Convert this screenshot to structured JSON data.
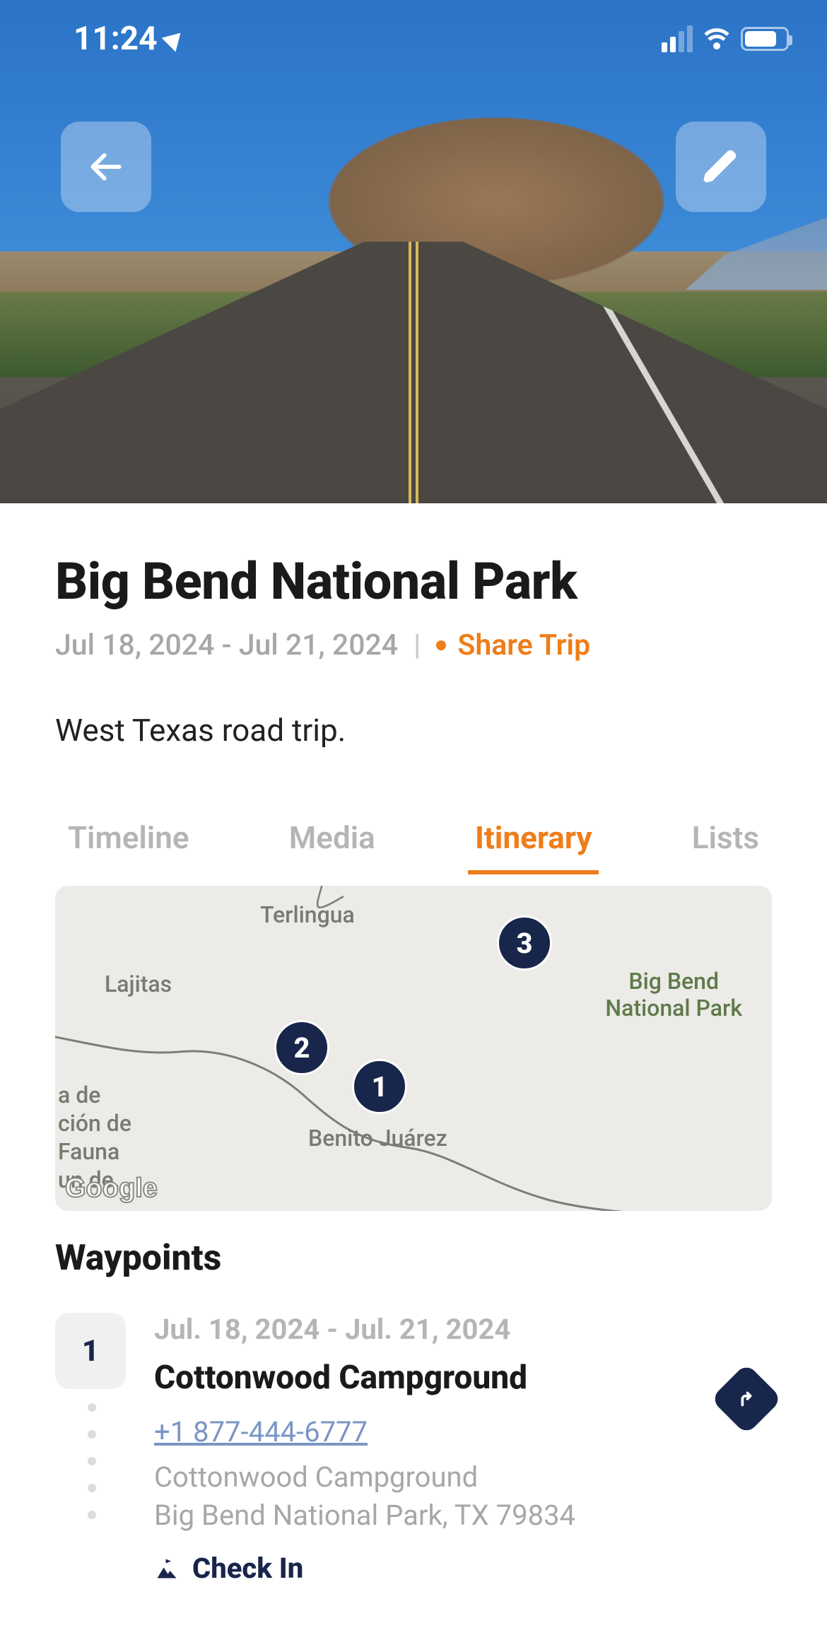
{
  "status_bar": {
    "time": "11:24"
  },
  "trip": {
    "title": "Big Bend National Park",
    "date_range": "Jul 18, 2024 - Jul 21, 2024",
    "share_label": "Share Trip",
    "description": "West Texas road trip."
  },
  "tabs": [
    {
      "label": "Timeline",
      "active": false
    },
    {
      "label": "Media",
      "active": false
    },
    {
      "label": "Itinerary",
      "active": true
    },
    {
      "label": "Lists",
      "active": false
    }
  ],
  "map": {
    "labels": {
      "terlingua": "Terlingua",
      "lajitas": "Lajitas",
      "bbnp_line1": "Big Bend",
      "bbnp_line2": "National Park",
      "benito": "Benito Juárez",
      "fauna_line1": "a de",
      "fauna_line2": "ción de",
      "fauna_line3": "Fauna",
      "fauna_line4": "un de..."
    },
    "pins": [
      {
        "num": "1"
      },
      {
        "num": "2"
      },
      {
        "num": "3"
      }
    ],
    "attribution": "Google"
  },
  "waypoints_header": "Waypoints",
  "waypoints": [
    {
      "index": "1",
      "dates": "Jul. 18, 2024 - Jul. 21, 2024",
      "name": "Cottonwood Campground",
      "phone": "+1 877-444-6777",
      "address_line1": "Cottonwood Campground",
      "address_line2": "Big Bend National Park, TX 79834",
      "checkin_label": "Check In"
    }
  ],
  "colors": {
    "accent": "#ee7d1a",
    "navy": "#18264c"
  }
}
